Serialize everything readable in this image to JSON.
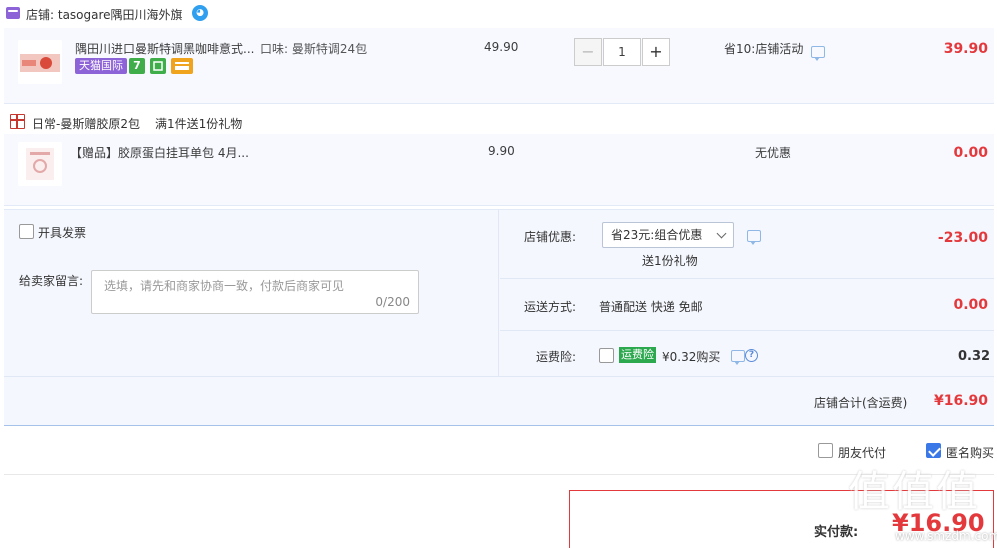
{
  "shop": {
    "name": "店铺: tasogare隅田川海外旗"
  },
  "item1": {
    "title": "隅田川进口曼斯特调黑咖啡意式...",
    "sku": "口味: 曼斯特调24包",
    "tag_label": "天猫国际",
    "badge7": "7",
    "price": "49.90",
    "quantity": "1",
    "minus": "−",
    "plus": "+",
    "promo": "省10:店铺活动",
    "total": "39.90"
  },
  "gift": {
    "label": "日常-曼斯赠胶原2包",
    "rule": "满1件送1份礼物"
  },
  "item2": {
    "title": "【赠品】胶原蛋白挂耳单包 4月...",
    "price": "9.90",
    "promo": "无优惠",
    "total": "0.00"
  },
  "options": {
    "invoice_label": "开具发票",
    "message_label": "给卖家留言:",
    "message_placeholder": "选填，请先和商家协商一致，付款后商家可见",
    "message_counter": "0/200",
    "shop_discount_label": "店铺优惠:",
    "shop_discount_selected": "省23元:组合优惠",
    "shop_discount_gift": "送1份礼物",
    "shop_discount_amount": "-23.00",
    "shipping_label": "运送方式:",
    "shipping_value": "普通配送 快递 免邮",
    "shipping_amount": "0.00",
    "insurance_label": "运费险:",
    "insurance_tag": "运费险",
    "insurance_text": "¥0.32购买",
    "insurance_amount": "0.32",
    "qmark": "?",
    "shop_total_label": "店铺合计(含运费)",
    "shop_total_value": "¥16.90"
  },
  "footer": {
    "friend_pay": "朋友代付",
    "anonymous": "匿名购买",
    "pay_label": "实付款:",
    "pay_value": "¥16.90"
  },
  "watermark": {
    "text": "值值值",
    "sub": "www.smzdm.com"
  },
  "colors": {
    "accent_red": "#e4393c",
    "tmall_purple": "#8d63d8",
    "insurance_green": "#2ca84f",
    "checkbox_blue": "#3b78e7"
  }
}
